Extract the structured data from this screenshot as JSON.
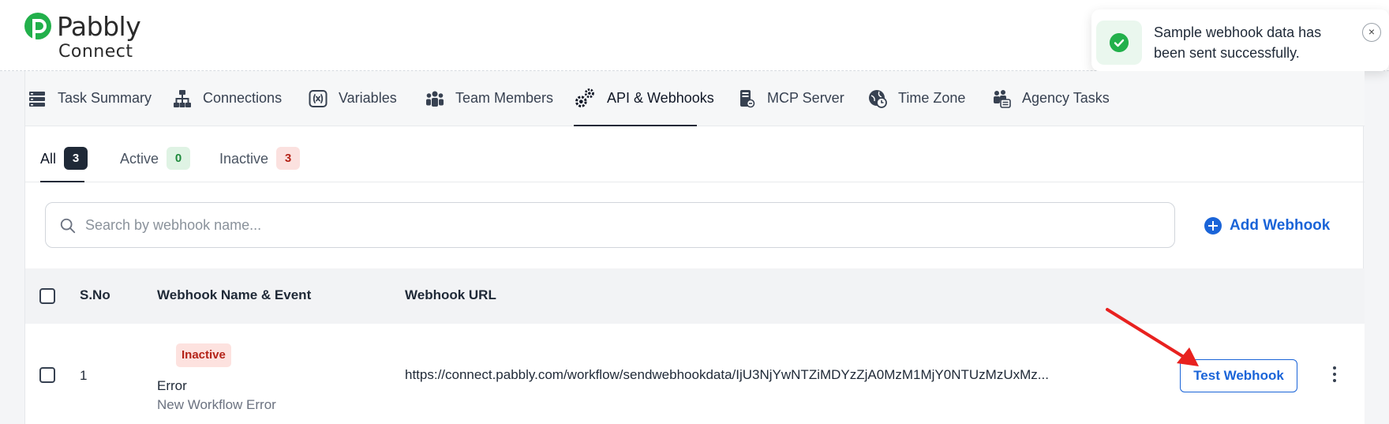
{
  "brand": {
    "name": "Pabbly",
    "product": "Connect",
    "accent": "#22b04b"
  },
  "toast": {
    "message": "Sample webhook data has been sent successfully.",
    "close_glyph": "×",
    "icon": "check-circle-icon"
  },
  "nav": {
    "items": [
      {
        "label": "Task Summary",
        "icon": "task-summary-icon"
      },
      {
        "label": "Connections",
        "icon": "connections-icon"
      },
      {
        "label": "Variables",
        "icon": "variables-icon"
      },
      {
        "label": "Team Members",
        "icon": "team-members-icon"
      },
      {
        "label": "API & Webhooks",
        "icon": "gears-icon",
        "active": true
      },
      {
        "label": "MCP Server",
        "icon": "mcp-server-icon"
      },
      {
        "label": "Time Zone",
        "icon": "time-zone-icon"
      },
      {
        "label": "Agency Tasks",
        "icon": "agency-tasks-icon"
      }
    ]
  },
  "filters": {
    "all": {
      "label": "All",
      "count": "3"
    },
    "active": {
      "label": "Active",
      "count": "0"
    },
    "inactive": {
      "label": "Inactive",
      "count": "3"
    }
  },
  "search": {
    "placeholder": "Search by webhook name...",
    "value": ""
  },
  "add_webhook": {
    "label": "Add Webhook"
  },
  "table": {
    "headers": {
      "sno": "S.No",
      "name_event": "Webhook Name & Event",
      "url": "Webhook URL"
    },
    "rows": [
      {
        "sno": "1",
        "status": "Inactive",
        "name": "Error",
        "event": "New Workflow Error",
        "url": "https://connect.pabbly.com/workflow/sendwebhookdata/IjU3NjYwNTZiMDYzZjA0MzM1MjY0NTUzMzUxMz...",
        "action_label": "Test Webhook"
      }
    ]
  },
  "colors": {
    "primary": "#1a64d8",
    "danger": "#b42318",
    "success": "#1e8a3c",
    "annotation_arrow": "#e8211f"
  }
}
